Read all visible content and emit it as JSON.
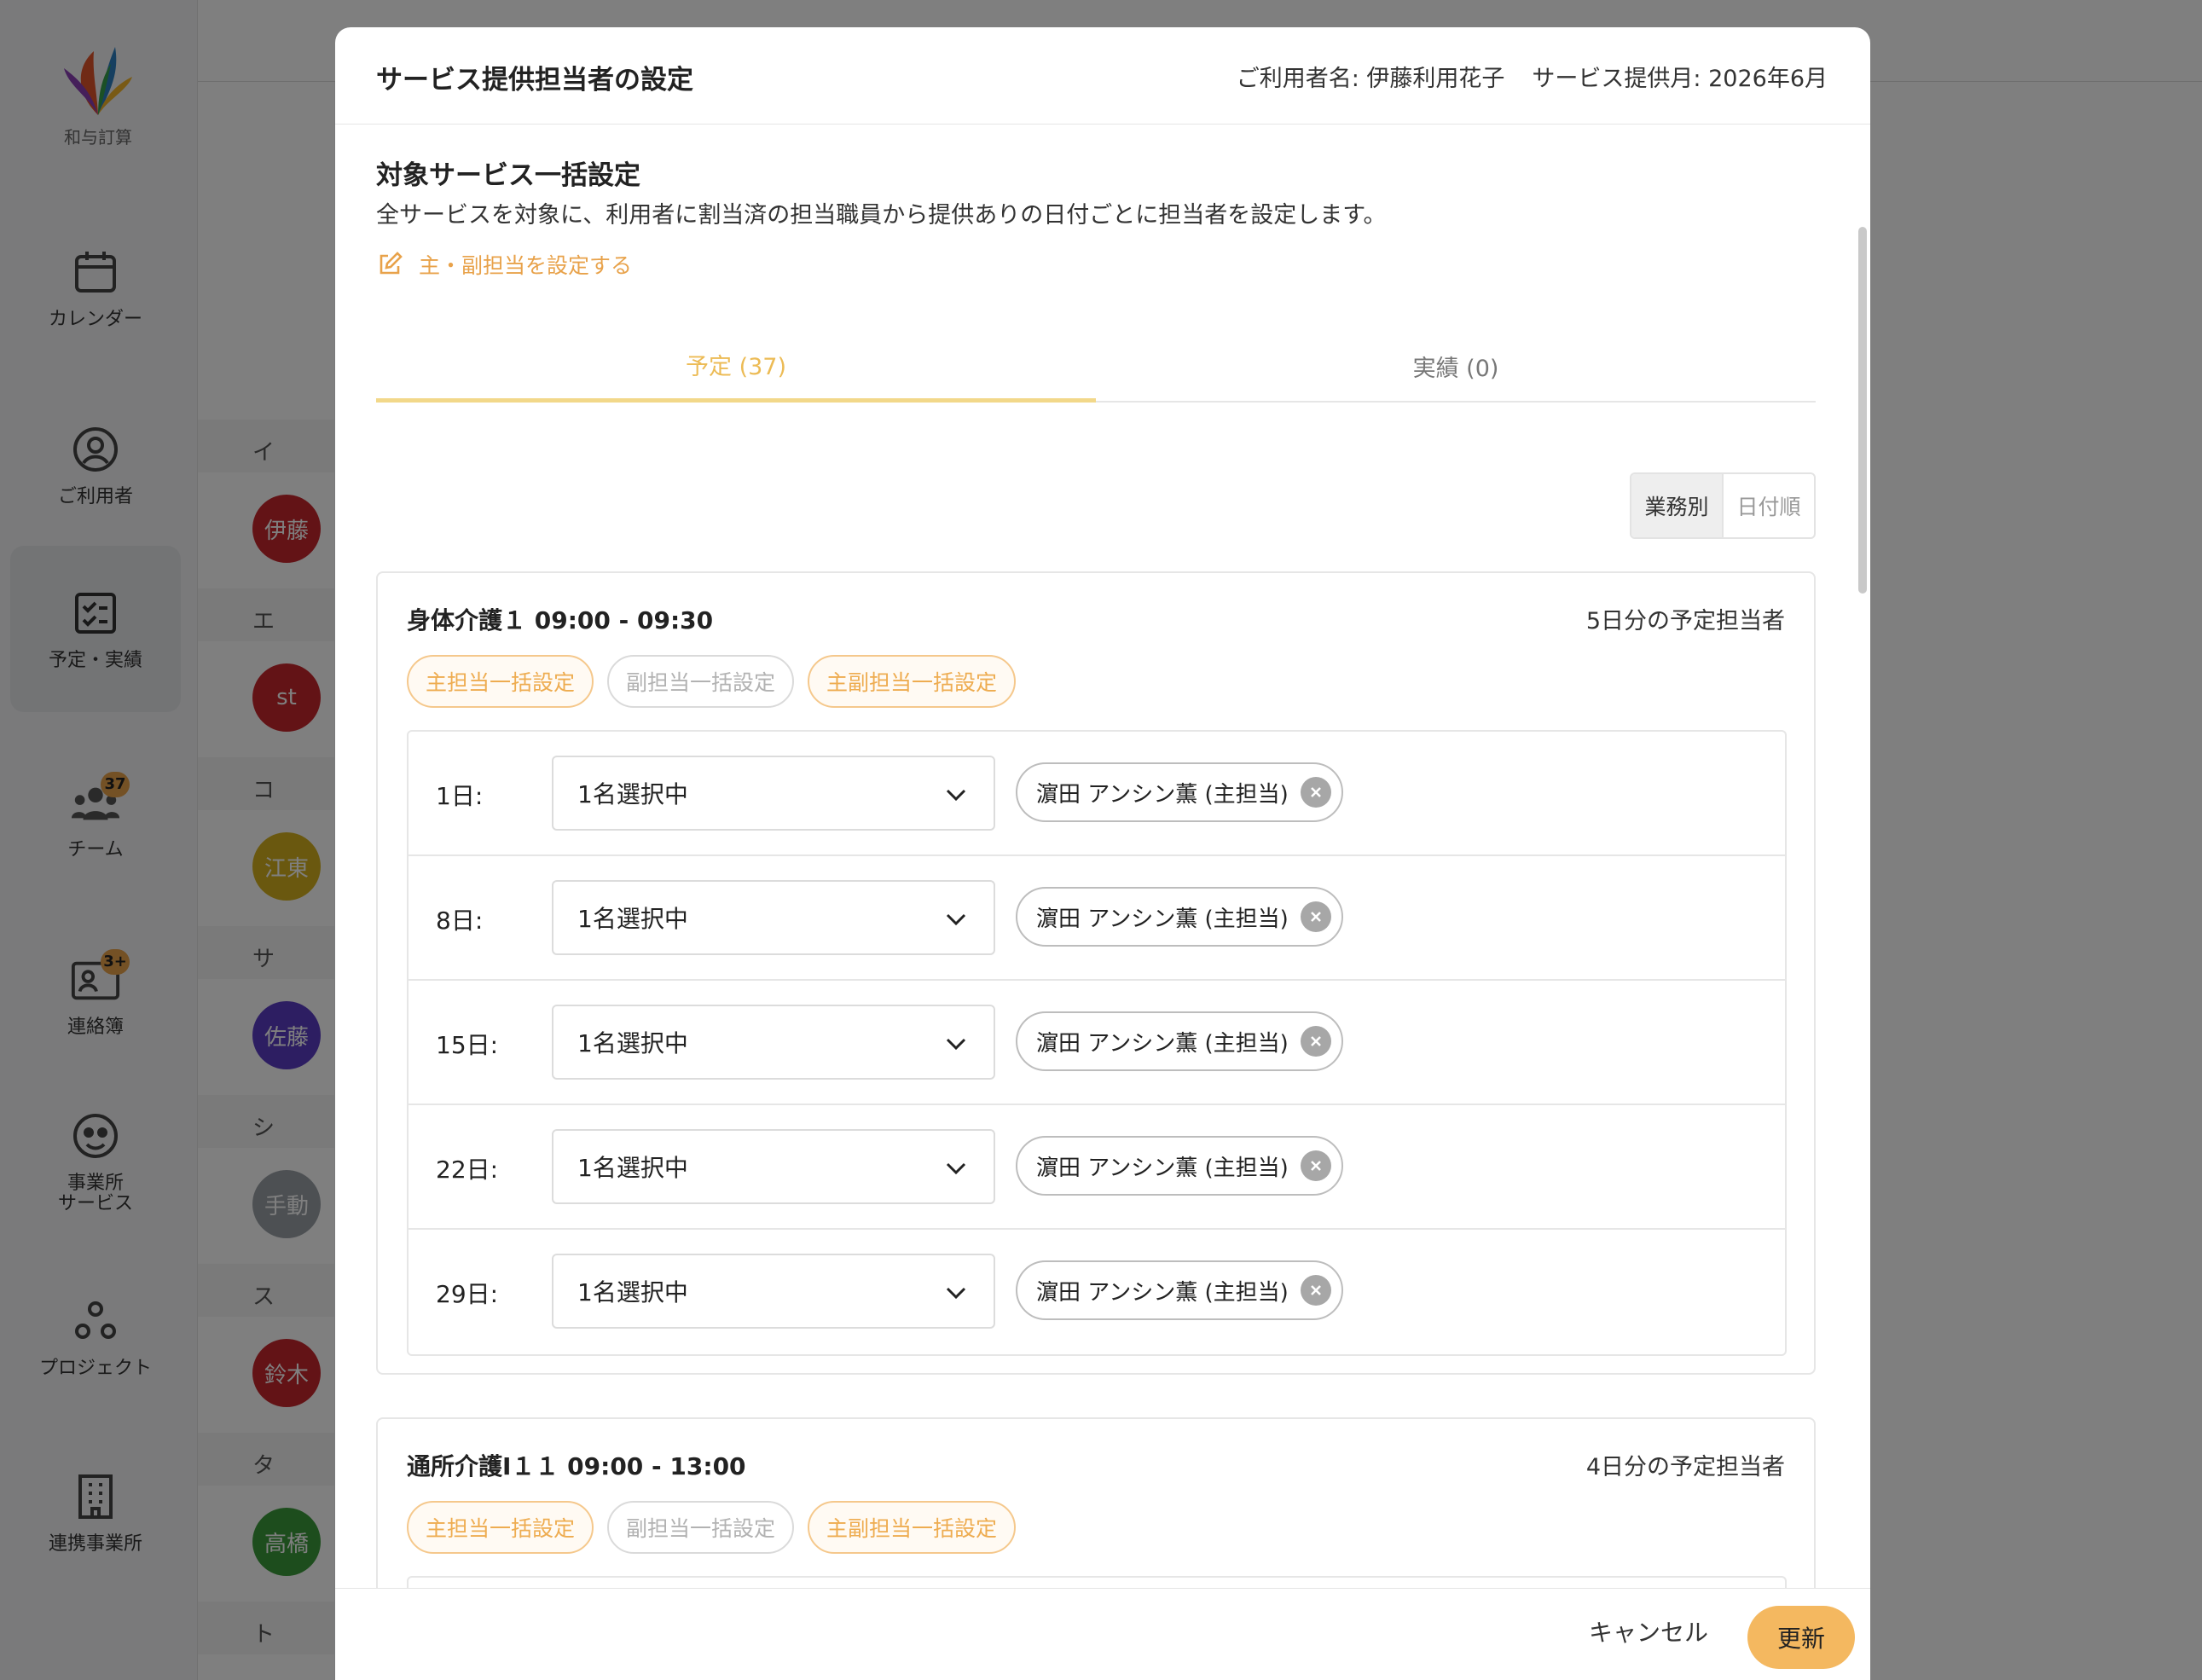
{
  "app": {
    "logo_text": "和与訂算",
    "nav": [
      {
        "label": "カレンダー",
        "icon": "calendar-icon"
      },
      {
        "label": "ご利用者",
        "icon": "user-circle-icon"
      },
      {
        "label": "予定・実績",
        "icon": "checklist-icon"
      },
      {
        "label": "チーム",
        "icon": "team-icon",
        "badge": "37"
      },
      {
        "label": "連絡簿",
        "icon": "contact-book-icon",
        "badge": "3+"
      },
      {
        "label": "事業所\nサービス",
        "icon": "office-service-icon"
      },
      {
        "label": "プロジェクト",
        "icon": "project-icon"
      },
      {
        "label": "連携事業所",
        "icon": "building-icon"
      }
    ],
    "list_heads": [
      "イ",
      "エ",
      "コ",
      "サ",
      "シ",
      "ス",
      "タ",
      "ト"
    ],
    "list_avatars": [
      "伊藤",
      "st",
      "江東",
      "佐藤",
      "手動",
      "鈴木",
      "高橋"
    ],
    "colors": {
      "accent": "#f4b860",
      "avatar_red": "#c6262c",
      "avatar_yellow": "#d4b11f",
      "avatar_purple": "#5b3cc4",
      "avatar_grey": "#9aa0a6",
      "avatar_green": "#3a9b3a"
    }
  },
  "modal": {
    "title": "サービス提供担当者の設定",
    "user_label": "ご利用者名: 伊藤利用花子",
    "month_label": "サービス提供月: 2026年6月",
    "section_title": "対象サービス一括設定",
    "section_desc": "全サービスを対象に、利用者に割当済の担当職員から提供ありの日付ごとに担当者を設定します。",
    "link_label": "主・副担当を設定する",
    "tabs": [
      {
        "label": "予定 (37)",
        "active": true
      },
      {
        "label": "実績 (0)",
        "active": false
      }
    ],
    "view_toggle": [
      {
        "label": "業務別",
        "active": true
      },
      {
        "label": "日付順",
        "active": false
      }
    ],
    "cards": [
      {
        "title": "身体介護１ 09:00 - 09:30",
        "count": "5日分の予定担当者",
        "chips": [
          "主担当一括設定",
          "副担当一括設定",
          "主副担当一括設定"
        ],
        "rows": [
          {
            "day": "1日:",
            "select": "1名選択中",
            "tag": "濵田 アンシン薫 (主担当)"
          },
          {
            "day": "8日:",
            "select": "1名選択中",
            "tag": "濵田 アンシン薫 (主担当)"
          },
          {
            "day": "15日:",
            "select": "1名選択中",
            "tag": "濵田 アンシン薫 (主担当)"
          },
          {
            "day": "22日:",
            "select": "1名選択中",
            "tag": "濵田 アンシン薫 (主担当)"
          },
          {
            "day": "29日:",
            "select": "1名選択中",
            "tag": "濵田 アンシン薫 (主担当)"
          }
        ]
      },
      {
        "title": "通所介護Ⅰ１１ 09:00 - 13:00",
        "count": "4日分の予定担当者",
        "chips": [
          "主担当一括設定",
          "副担当一括設定",
          "主副担当一括設定"
        ]
      }
    ],
    "cancel_label": "キャンセル",
    "update_label": "更新"
  }
}
